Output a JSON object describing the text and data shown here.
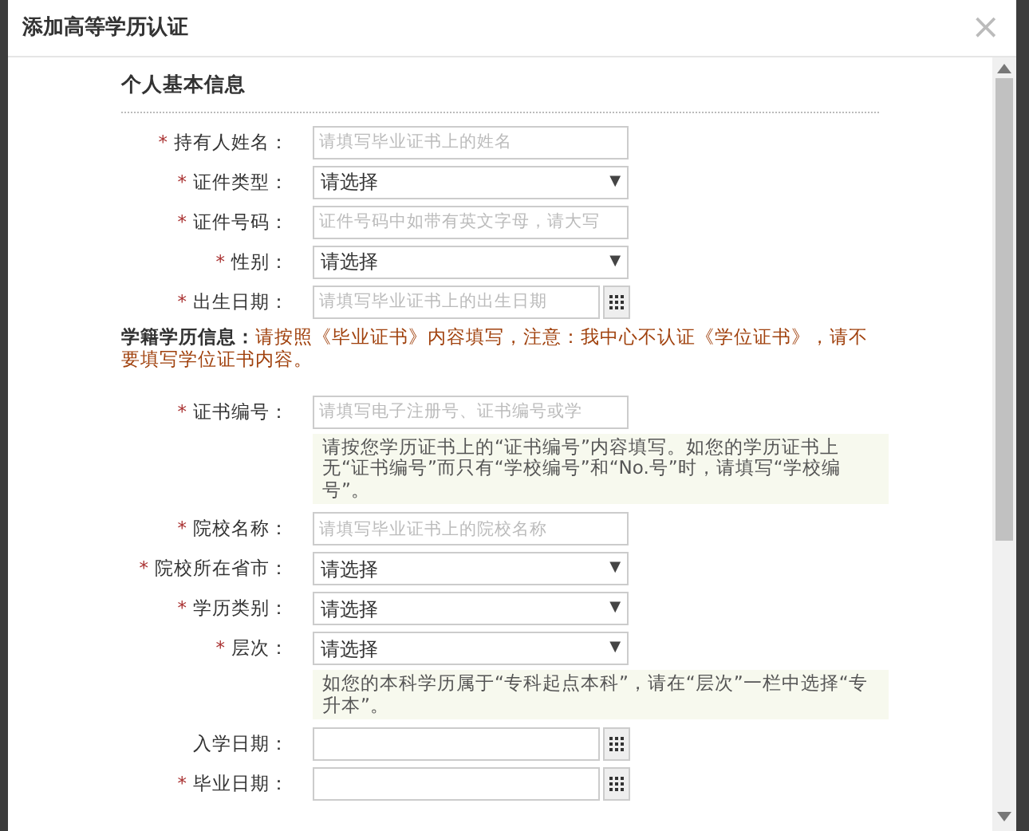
{
  "dialog": {
    "title": "添加高等学历认证",
    "close": "×"
  },
  "section_title": "个人基本信息",
  "items": [
    {
      "kind": "text",
      "star": "*",
      "label": "持有人姓名：",
      "placeholder": "请填写毕业证书上的姓名"
    },
    {
      "kind": "select",
      "star": "*",
      "label": "证件类型：",
      "value": "请选择",
      "caret": "▼"
    },
    {
      "kind": "text",
      "star": "*",
      "label": "证件号码：",
      "placeholder": "证件号码中如带有英文字母，请大写"
    },
    {
      "kind": "select",
      "star": "*",
      "label": "性别：",
      "value": "请选择",
      "caret": "▼"
    },
    {
      "kind": "date",
      "star": "*",
      "label": "出生日期：",
      "placeholder": "请填写毕业证书上的出生日期"
    },
    {
      "kind": "notice",
      "text": "**学籍学历信息：**请按照《毕业证书》内容填写，注意：我中心不认证《学位证书》，请不要填写学位证书内容。"
    },
    {
      "kind": "text",
      "star": "*",
      "label": "证书编号：",
      "placeholder": "请填写电子注册号、证书编号或学"
    },
    {
      "kind": "hint",
      "text": "请按您学历证书上的“证书编号”内容填写。如您的学历证书上无“证书编号”而只有“学校编号”和“No.号”时，请填写“学校编号”。"
    },
    {
      "kind": "text",
      "star": "*",
      "label": "院校名称：",
      "placeholder": "请填写毕业证书上的院校名称"
    },
    {
      "kind": "select",
      "star": "*",
      "label": "院校所在省市：",
      "value": "请选择",
      "caret": "▼"
    },
    {
      "kind": "select",
      "star": "*",
      "label": "学历类别：",
      "value": "请选择",
      "caret": "▼"
    },
    {
      "kind": "select",
      "star": "*",
      "label": "层次：",
      "value": "请选择",
      "caret": "▼"
    },
    {
      "kind": "hint",
      "text": "如您的本科学历属于“专科起点本科”，请在“层次”一栏中选择“专升本”。"
    },
    {
      "kind": "date",
      "label": "入学日期："
    },
    {
      "kind": "date",
      "star": "*",
      "label": "毕业日期："
    }
  ]
}
